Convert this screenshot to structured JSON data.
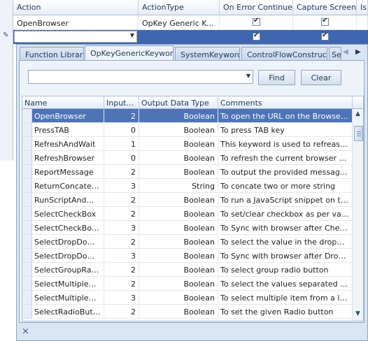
{
  "grid": {
    "columns": [
      "Action",
      "ActionType",
      "On Error Continue",
      "Capture Screen",
      "Is"
    ],
    "rows": [
      {
        "action": "OpenBrowser",
        "type": "OpKey Generic Key...",
        "on_error": true,
        "capture": true
      },
      {
        "action": "",
        "type": "",
        "on_error": true,
        "capture": true
      }
    ]
  },
  "tabs": [
    "Function Library",
    "OpKeyGenericKeyword",
    "SystemKeyword",
    "ControlFlowConstruct",
    "Se"
  ],
  "search": {
    "value": ""
  },
  "buttons": {
    "find": "Find",
    "clear": "Clear"
  },
  "table": {
    "headers": [
      "Name",
      "Input...",
      "Output Data Type",
      "Comments"
    ],
    "rows": [
      {
        "name": "OpenBrowser",
        "inputs": "2",
        "out": "Boolean",
        "comment": "To open the URL on the Browser na..."
      },
      {
        "name": "PressTAB",
        "inputs": "0",
        "out": "Boolean",
        "comment": "To press TAB key"
      },
      {
        "name": "RefreshAndWait",
        "inputs": "1",
        "out": "Boolean",
        "comment": "This keyword is used to refreash bro..."
      },
      {
        "name": "RefreshBrowser",
        "inputs": "0",
        "out": "Boolean",
        "comment": "To refresh the current browser sessi..."
      },
      {
        "name": "ReportMessage",
        "inputs": "2",
        "out": "Boolean",
        "comment": "To output the provided message; us..."
      },
      {
        "name": "ReturnConcaten...",
        "inputs": "3",
        "out": "String",
        "comment": "To concate two or more string"
      },
      {
        "name": "RunScriptAndWait",
        "inputs": "2",
        "out": "Boolean",
        "comment": "To run a JavaScript snippet on the ..."
      },
      {
        "name": "SelectCheckBox",
        "inputs": "2",
        "out": "Boolean",
        "comment": "To set/clear checkbox as per value(..."
      },
      {
        "name": "SelectCheckBox...",
        "inputs": "3",
        "out": "Boolean",
        "comment": "To Sync with browser after CheckBo..."
      },
      {
        "name": "SelectDropDown...",
        "inputs": "2",
        "out": "Boolean",
        "comment": "To select the value in the dropdown."
      },
      {
        "name": "SelectDropDown...",
        "inputs": "3",
        "out": "Boolean",
        "comment": "To Sync with browser after Dropdo..."
      },
      {
        "name": "SelectGroupRadi...",
        "inputs": "2",
        "out": "Boolean",
        "comment": "To select group radio button"
      },
      {
        "name": "SelectMultipleDro...",
        "inputs": "2",
        "out": "Boolean",
        "comment": "To select the values separated by d..."
      },
      {
        "name": "SelectMultipleDro...",
        "inputs": "3",
        "out": "Boolean",
        "comment": "To select multiple item from a list bo..."
      },
      {
        "name": "SelectRadioButton",
        "inputs": "2",
        "out": "Boolean",
        "comment": "To set the given Radio button"
      }
    ]
  },
  "footer": {
    "close_glyph": "×"
  }
}
